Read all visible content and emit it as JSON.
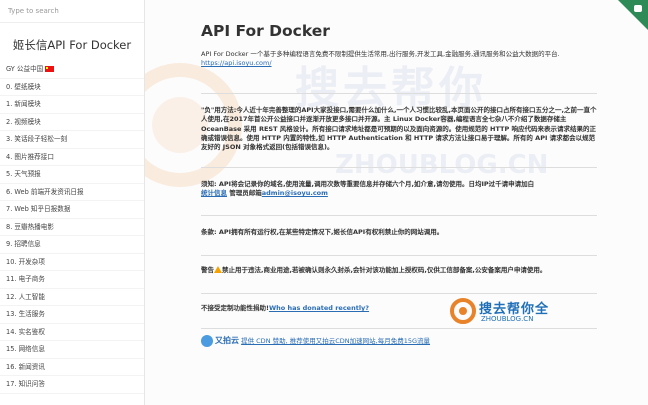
{
  "search": {
    "placeholder": "Type to search"
  },
  "sidebar": {
    "brand": "姬长信API For Docker",
    "items": [
      {
        "label": "GY 公益中国",
        "flag": true
      },
      {
        "label": "0. 壁纸模块"
      },
      {
        "label": "1. 新闻模块"
      },
      {
        "label": "2. 视频模块"
      },
      {
        "label": "3. 笑话段子轻松一刻"
      },
      {
        "label": "4. 图片推荐接口"
      },
      {
        "label": "5. 天气预报"
      },
      {
        "label": "6. Web 前端开发资讯日报"
      },
      {
        "label": "7. Web 知乎日报数据"
      },
      {
        "label": "8. 豆瓣热播电影"
      },
      {
        "label": "9. 招聘信息"
      },
      {
        "label": "10. 开发杂项"
      },
      {
        "label": "11. 电子商务"
      },
      {
        "label": "12. 人工智能"
      },
      {
        "label": "13. 生活服务"
      },
      {
        "label": "14. 实名鉴权"
      },
      {
        "label": "15. 网络信息"
      },
      {
        "label": "16. 新闻资讯"
      },
      {
        "label": "17. 知识问答"
      }
    ]
  },
  "main": {
    "title": "API For Docker",
    "intro": "API For Docker 一个基于多种编程语言免费不限制提供生活常用,出行服务,开发工具,金融服务,通讯服务和公益大数据的平台.",
    "intro_link": "https://api.isoyu.com/",
    "para2_prefix": "\"负\"用方法:今人近十年完善整理的API大家投接口,需要什么加什么,一个人习惯比较乱,本页面公开的接口占所有接口五分之一,之前一直个人使用,在2017年首公开公益接口并逐渐开放更多接口并开源。主 Linux Docker容器,编程语言全七杂八不介绍了数据存储主OceanBase 采用 REST 风格设计。所有接口请求地址都是可预期的以及面向资源的。使用规范的 HTTP 响应代码来表示请求结果的正确或错误信息。使用 HTTP 内置的特性,如 HTTP Authentication 和 HTTP 请求方法让接口易于理解。所有的 API 请求都会以规范友好的 JSON 对象格式返回(包括错误信息)。",
    "para3": "须知: API将会记录你的域名,使用流量,调用次数等重要信息并存储六个月,如介意,请勿使用。日均IP过千请申请加白",
    "stats_label": "统计信息",
    "admin_label": "管理员邮箱",
    "admin_email": "admin@isoyu.com",
    "para4": "条款: API拥有所有运行权,在某些特定情况下,姬长信API有权利禁止你的网站调用。",
    "para5_prefix": "警告",
    "para5": "禁止用于违法,商业用途,若被确认则永久封杀,会针对该功能加上授权码,仅供工信部备案,公安备案用户申请使用。",
    "para6": "不接受定制功能性捐助!",
    "para6_link": "Who has donated recently?",
    "upyun_label": "又拍云",
    "upyun_text": "提供 CDN 赞助, 推荐使用又拍云CDN加速网站,每月免费15G流量",
    "watermark1": "搜去帮你",
    "watermark2": "ZHOUBLOG.CN",
    "badge_text": "搜去帮你全",
    "badge_url": "ZHOUBLOG.CN"
  }
}
